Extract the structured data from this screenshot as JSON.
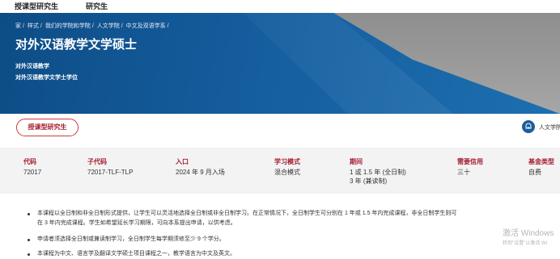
{
  "topnav": {
    "items": [
      "授课型研究生",
      "研究生"
    ]
  },
  "hero": {
    "breadcrumb": [
      "家",
      "样式",
      "我们的学院和学院",
      "人文学院",
      "中文及双语学系"
    ],
    "breadcrumb_sep": "/",
    "title": "对外汉语教学文学硕士",
    "subtitle_1": "对外汉语教学",
    "subtitle_2": "对外汉语教学文学士学位"
  },
  "program_tag": "授课型研究生",
  "faculty_label": "人文学院",
  "info": {
    "code": {
      "label": "代码",
      "value": "72017"
    },
    "subcode": {
      "label": "子代码",
      "value": "72017-TLF-TLP"
    },
    "entry": {
      "label": "入口",
      "value": "2024 年 9 月入场"
    },
    "mode": {
      "label": "学习模式",
      "value": "混合模式"
    },
    "duration": {
      "label": "期间",
      "value_1": "1 或 1.5 年 (全日制)",
      "value_2": "3 年 (兼读制)"
    },
    "credits": {
      "label": "需要信用",
      "value": "三十"
    },
    "fund": {
      "label": "基金类型",
      "value": "自费"
    }
  },
  "bullets": [
    "本课程以全日制和非全日制形式提供，让学生可以灵活地选择全日制或非全日制学习。在正常情况下，全日制学生可分别在 1 年或 1.5 年内完成课程，非全日制学生则可",
    "在 3 年内完成课程。学生如希望延长学习期限，可向本系提出申请，以供考虑。",
    "申请者须选择全日制或兼读制学习，全日制学生每学期须修至少 9 个学分。",
    "本课程为中文、语言学及翻译文学硕士项目课程之一，教学语言为中文及英文。"
  ],
  "watermark": {
    "line1": "激活 Windows",
    "line2": "转到\"设置\"以激活 Wi"
  }
}
